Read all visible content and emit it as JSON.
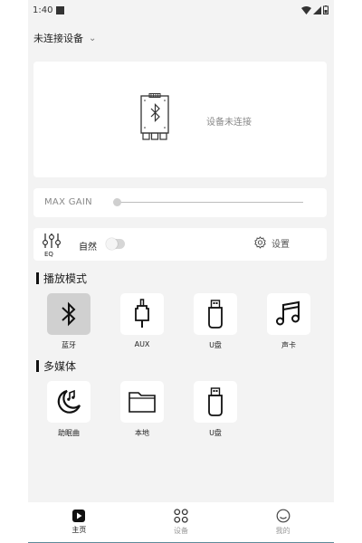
{
  "status_bar": {
    "time": "1:40"
  },
  "header": {
    "device_select_label": "未连接设备"
  },
  "device_card": {
    "status_text": "设备未连接"
  },
  "gain": {
    "label": "MAX GAIN",
    "level": 0.0
  },
  "eq": {
    "icon_label": "EQ",
    "preset": "自然",
    "enabled": false,
    "settings_label": "设置"
  },
  "play_mode": {
    "title": "播放模式",
    "items": [
      {
        "label": "蓝牙",
        "icon": "bluetooth-icon",
        "active": true
      },
      {
        "label": "AUX",
        "icon": "aux-jack-icon",
        "active": false
      },
      {
        "label": "U盘",
        "icon": "usb-drive-icon",
        "active": false
      },
      {
        "label": "声卡",
        "icon": "music-note-icon",
        "active": false
      }
    ]
  },
  "media": {
    "title": "多媒体",
    "items": [
      {
        "label": "助眠曲",
        "icon": "sleep-moon-icon"
      },
      {
        "label": "本地",
        "icon": "folder-icon"
      },
      {
        "label": "U盘",
        "icon": "usb-drive-icon"
      }
    ]
  },
  "bottom_nav": {
    "items": [
      {
        "label": "主页",
        "icon": "play-home-icon",
        "active": true
      },
      {
        "label": "设备",
        "icon": "devices-grid-icon",
        "active": false
      },
      {
        "label": "我的",
        "icon": "profile-icon",
        "active": false
      }
    ]
  },
  "colors": {
    "active_tile": "#d0d0d0",
    "background": "#f3f3f3",
    "card": "#ffffff"
  }
}
